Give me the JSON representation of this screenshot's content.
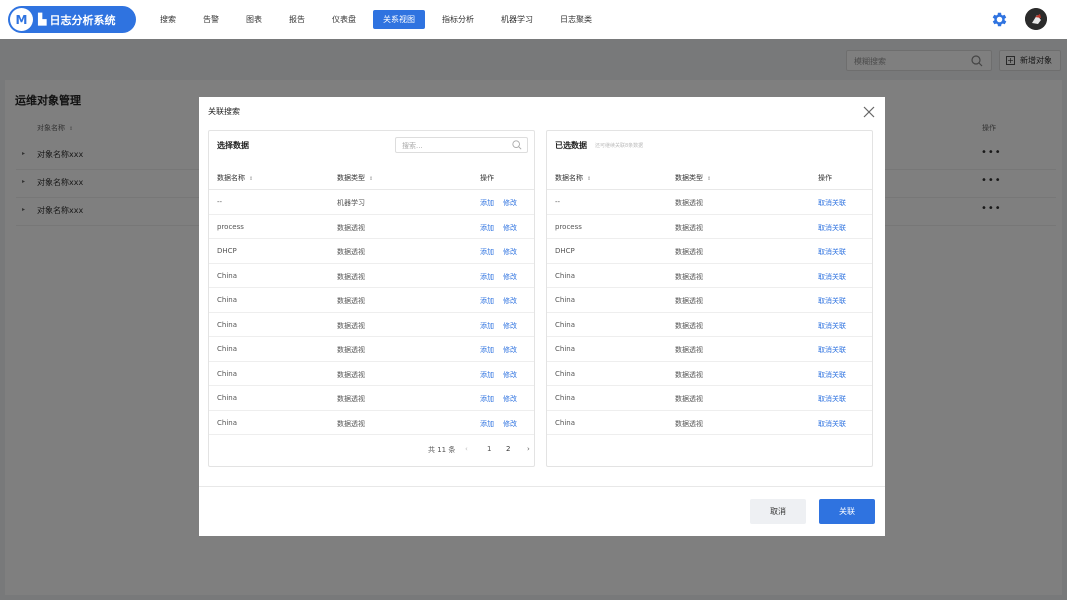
{
  "app": {
    "title": "日志分析系统",
    "logo_letter": "M"
  },
  "nav": {
    "items": [
      {
        "label": "搜索",
        "active": false
      },
      {
        "label": "告警",
        "active": false
      },
      {
        "label": "图表",
        "active": false
      },
      {
        "label": "报告",
        "active": false
      },
      {
        "label": "仪表盘",
        "active": false
      },
      {
        "label": "关系视图",
        "active": true
      },
      {
        "label": "指标分析",
        "active": false
      },
      {
        "label": "机器学习",
        "active": false
      },
      {
        "label": "日志聚类",
        "active": false
      }
    ]
  },
  "page": {
    "search_placeholder": "模糊搜索",
    "new_button": "新增对象",
    "title": "运维对象管理",
    "col_name": "对象名称",
    "col_op": "操作",
    "rows": [
      "对象名称xxx",
      "对象名称xxx",
      "对象名称xxx"
    ],
    "more": "•••"
  },
  "modal": {
    "title": "关联搜索",
    "left": {
      "title": "选择数据",
      "search_placeholder": "搜索...",
      "headers": {
        "name": "数据名称",
        "type": "数据类型",
        "op": "操作"
      },
      "rows": [
        {
          "name": "--",
          "type": "机器学习"
        },
        {
          "name": "process",
          "type": "数据透视"
        },
        {
          "name": "DHCP",
          "type": "数据透视"
        },
        {
          "name": "China",
          "type": "数据透视"
        },
        {
          "name": "China",
          "type": "数据透视"
        },
        {
          "name": "China",
          "type": "数据透视"
        },
        {
          "name": "China",
          "type": "数据透视"
        },
        {
          "name": "China",
          "type": "数据透视"
        },
        {
          "name": "China",
          "type": "数据透视"
        },
        {
          "name": "China",
          "type": "数据透视"
        }
      ],
      "add_label": "添加",
      "edit_label": "修改",
      "pager": {
        "total": "共 11 条",
        "prev": "‹",
        "pages": [
          "1",
          "2"
        ],
        "next": "›"
      }
    },
    "right": {
      "title": "已选数据",
      "hint": "还可继续关联8条数据",
      "headers": {
        "name": "数据名称",
        "type": "数据类型",
        "op": "操作"
      },
      "rows": [
        {
          "name": "--",
          "type": "数据透视"
        },
        {
          "name": "process",
          "type": "数据透视"
        },
        {
          "name": "DHCP",
          "type": "数据透视"
        },
        {
          "name": "China",
          "type": "数据透视"
        },
        {
          "name": "China",
          "type": "数据透视"
        },
        {
          "name": "China",
          "type": "数据透视"
        },
        {
          "name": "China",
          "type": "数据透视"
        },
        {
          "name": "China",
          "type": "数据透视"
        },
        {
          "name": "China",
          "type": "数据透视"
        },
        {
          "name": "China",
          "type": "数据透视"
        }
      ],
      "unlink_label": "取消关联"
    },
    "cancel_button": "取消",
    "ok_button": "关联"
  },
  "colors": {
    "primary": "#2f73e0",
    "mask": "rgba(0,0,0,0.5)"
  },
  "icons": {
    "settings": "gear-icon",
    "search": "search-icon",
    "close": "close-icon",
    "add": "plus-icon"
  }
}
